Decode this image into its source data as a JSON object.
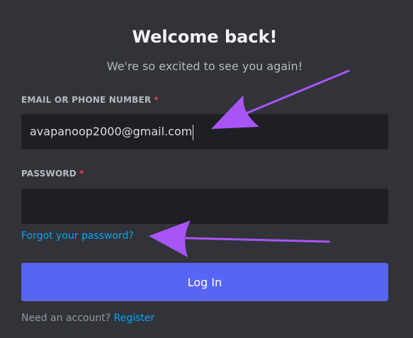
{
  "header": {
    "title": "Welcome back!",
    "subtitle": "We're so excited to see you again!"
  },
  "form": {
    "email": {
      "label": "EMAIL OR PHONE NUMBER",
      "required_mark": "*",
      "value": "avapanoop2000@gmail.com"
    },
    "password": {
      "label": "PASSWORD",
      "required_mark": "*",
      "value": ""
    },
    "forgot_link": "Forgot your password?",
    "login_button": "Log In",
    "need_account_text": "Need an account?",
    "register_link": "Register"
  },
  "colors": {
    "background": "#313338",
    "input_background": "#1e1f22",
    "brand": "#5865f2",
    "link": "#00a8fc",
    "required": "#f23f43",
    "annotation_arrow": "#a855f7"
  }
}
